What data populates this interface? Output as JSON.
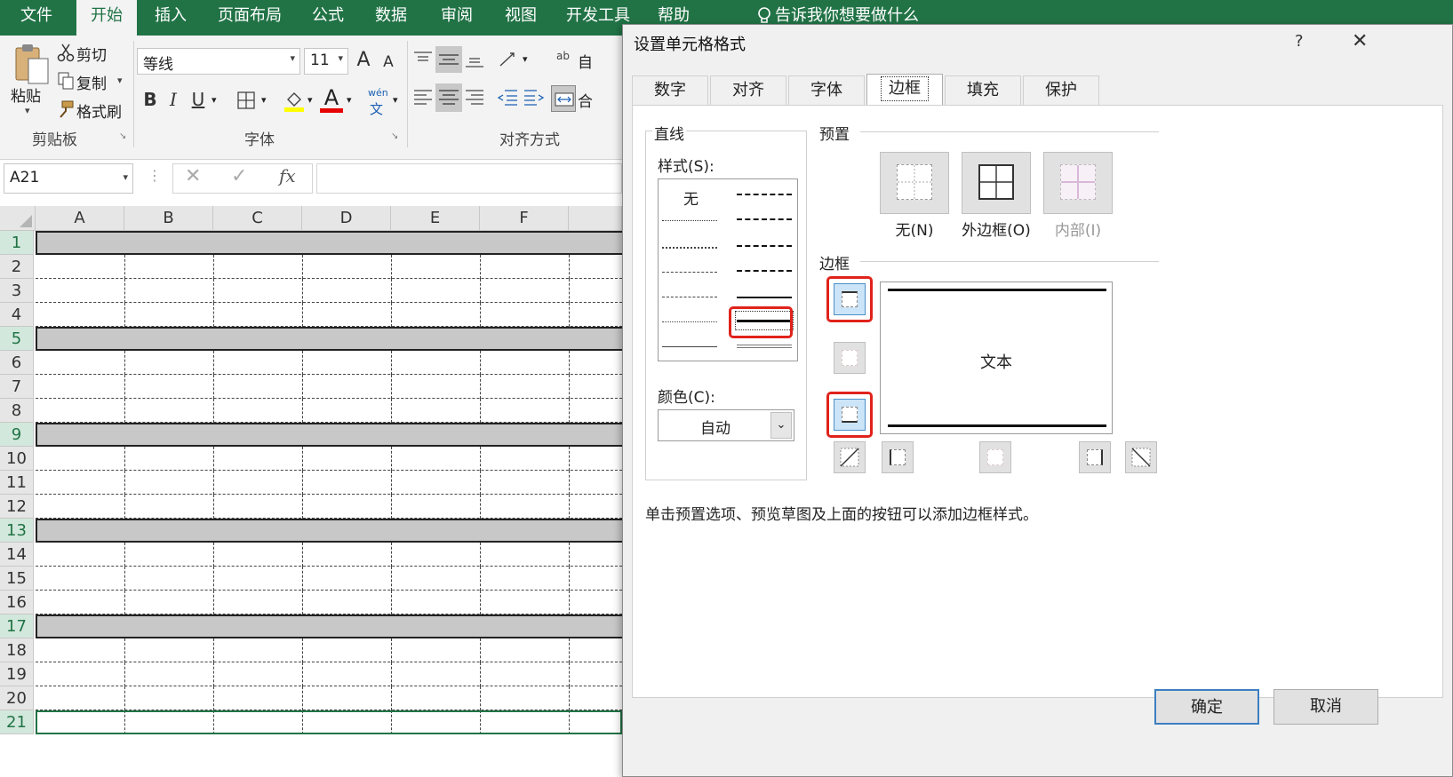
{
  "menu": [
    "文件",
    "开始",
    "插入",
    "页面布局",
    "公式",
    "数据",
    "审阅",
    "视图",
    "开发工具",
    "帮助"
  ],
  "tell_me": "告诉我你想要做什么",
  "ribbon": {
    "paste": "粘贴",
    "cut": "剪切",
    "copy": "复制",
    "format_painter": "格式刷",
    "clipboard_label": "剪贴板",
    "font_name": "等线",
    "font_size": "11",
    "font_group_label": "字体",
    "align_group_label": "对齐方式",
    "wrap_partial": "自",
    "merge_partial": "合",
    "bold": "B",
    "italic": "I",
    "underline": "U",
    "grow_font": "A",
    "shrink_font": "A",
    "phonetic_top": "wén",
    "phonetic_bottom": "文",
    "font_color_letter": "A"
  },
  "formula_bar": {
    "name_box": "A21",
    "fx": "fx"
  },
  "grid": {
    "columns": [
      "A",
      "B",
      "C",
      "D",
      "E",
      "F"
    ],
    "rows": [
      "1",
      "2",
      "3",
      "4",
      "5",
      "6",
      "7",
      "8",
      "9",
      "10",
      "11",
      "12",
      "13",
      "14",
      "15",
      "16",
      "17",
      "18",
      "19",
      "20",
      "21"
    ]
  },
  "dialog": {
    "title": "设置单元格格式",
    "help": "?",
    "close": "✕",
    "tabs": [
      "数字",
      "对齐",
      "字体",
      "边框",
      "填充",
      "保护"
    ],
    "active_tab": "边框",
    "line_section": "直线",
    "style_label": "样式(S):",
    "style_none": "无",
    "color_label": "颜色(C):",
    "color_value": "自动",
    "presets_label": "预置",
    "preset_none": "无(N)",
    "preset_outline": "外边框(O)",
    "preset_inside": "内部(I)",
    "border_label": "边框",
    "preview_text": "文本",
    "hint": "单击预置选项、预览草图及上面的按钮可以添加边框样式。",
    "ok": "确定",
    "cancel": "取消"
  },
  "colors": {
    "excel_green": "#217346",
    "highlight_red": "#e0231b",
    "selected_blue": "#cce4f7"
  }
}
